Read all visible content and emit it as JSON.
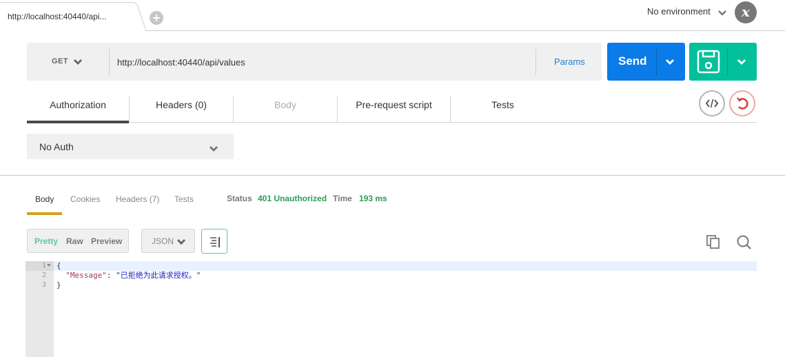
{
  "tabs": {
    "active_tab_label": "http://localhost:40440/api...",
    "add_tab_icon": "plus-circle-icon"
  },
  "environment": {
    "selected": "No environment"
  },
  "logo": {
    "glyph": "x"
  },
  "request": {
    "method": "GET",
    "url": "http://localhost:40440/api/values",
    "url_placeholder": "Enter request URL",
    "params_label": "Params",
    "send_label": "Send",
    "save_icon": "floppy-disk-icon"
  },
  "request_tabs": [
    {
      "label": "Authorization",
      "active": true,
      "disabled": false
    },
    {
      "label": "Headers (0)",
      "active": false,
      "disabled": false
    },
    {
      "label": "Body",
      "active": false,
      "disabled": true
    },
    {
      "label": "Pre-request script",
      "active": false,
      "disabled": false
    },
    {
      "label": "Tests",
      "active": false,
      "disabled": false
    }
  ],
  "request_actions": {
    "code_icon": "code-icon",
    "reset_icon": "reset-icon"
  },
  "auth": {
    "type": "No Auth"
  },
  "response": {
    "tabs": [
      {
        "label": "Body",
        "active": true
      },
      {
        "label": "Cookies",
        "active": false
      },
      {
        "label": "Headers (7)",
        "active": false
      },
      {
        "label": "Tests",
        "active": false
      }
    ],
    "status_label": "Status",
    "status_value": "401 Unauthorized",
    "time_label": "Time",
    "time_value": "193 ms",
    "view_modes": [
      "Pretty",
      "Raw",
      "Preview"
    ],
    "active_view_mode": "Pretty",
    "format": "JSON",
    "colors": {
      "status_ok": "#2e9a5a",
      "active_underline": "#d4a01c",
      "pretty_active": "#5cc5a7"
    },
    "code_lines": [
      {
        "n": "1",
        "text": "{"
      },
      {
        "n": "2",
        "key": "\"Message\"",
        "sep": ": ",
        "value": "\"已拒绝为此请求授权。\""
      },
      {
        "n": "3",
        "text": "}"
      }
    ]
  },
  "brand_colors": {
    "send": "#0b7be8",
    "save": "#02c09c",
    "params_link": "#1e7fd6"
  }
}
